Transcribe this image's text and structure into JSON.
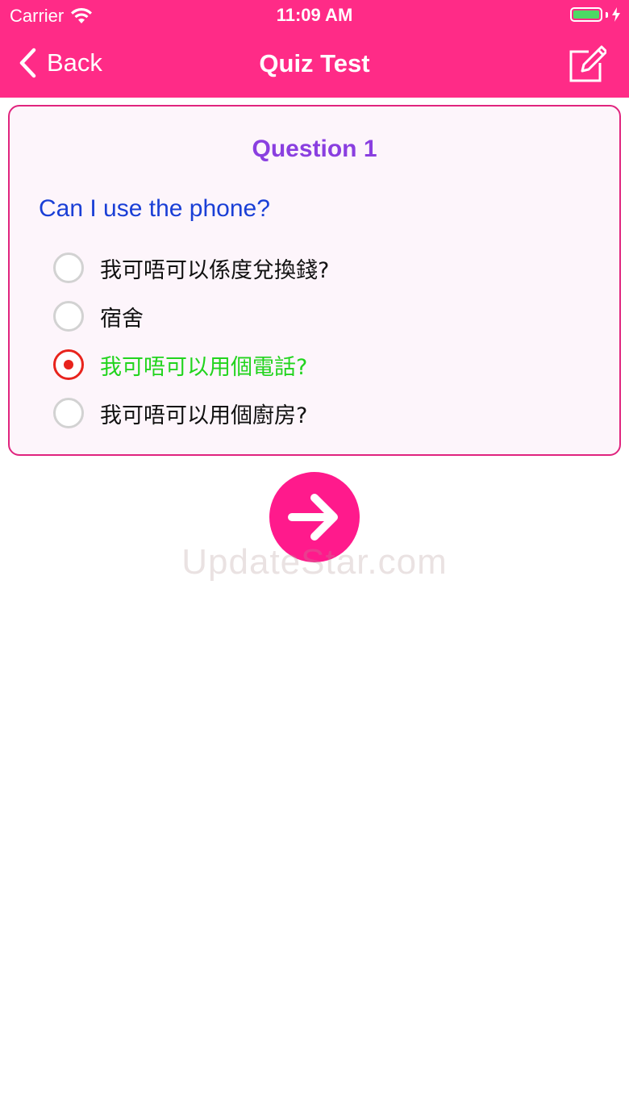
{
  "status_bar": {
    "carrier": "Carrier",
    "time": "11:09 AM",
    "battery_level": 1.0,
    "wifi_icon": "wifi-icon",
    "charging_icon": "bolt-icon"
  },
  "nav": {
    "back_label": "Back",
    "title": "Quiz Test",
    "back_icon": "chevron-left-icon",
    "action_icon": "compose-icon"
  },
  "quiz": {
    "question_number": "Question 1",
    "question_text": "Can I use the phone?",
    "options": [
      {
        "label": "我可唔可以係度兌換錢?",
        "selected": false
      },
      {
        "label": "宿舍",
        "selected": false
      },
      {
        "label": "我可唔可以用個電話?",
        "selected": true
      },
      {
        "label": "我可唔可以用個廚房?",
        "selected": false
      }
    ]
  },
  "next_button_icon": "arrow-right-icon",
  "watermark": "UpdateStar.com",
  "colors": {
    "brand_pink": "#ff2b87",
    "next_button": "#ff1a8c",
    "card_border": "#e0247e",
    "question_number": "#8a3fe0",
    "question_text": "#1a3fd6",
    "selected_answer": "#22d41e",
    "selected_radio": "#e8231c"
  }
}
